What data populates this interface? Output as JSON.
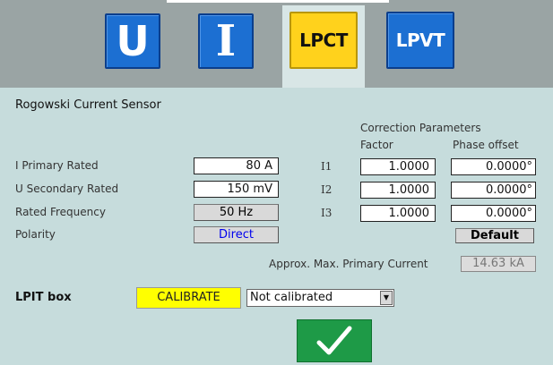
{
  "tabs": [
    {
      "label": "U",
      "active": false
    },
    {
      "label": "I",
      "active": false
    },
    {
      "label": "LPCT",
      "active": true
    },
    {
      "label": "LPVT",
      "active": false
    }
  ],
  "title": "Rogowski Current Sensor",
  "correction": {
    "heading": "Correction Parameters",
    "factor_header": "Factor",
    "phase_header": "Phase offset",
    "rows": [
      {
        "label": "I1",
        "factor": "1.0000",
        "phase": "0.0000°"
      },
      {
        "label": "I2",
        "factor": "1.0000",
        "phase": "0.0000°"
      },
      {
        "label": "I3",
        "factor": "1.0000",
        "phase": "0.0000°"
      }
    ],
    "default_label": "Default"
  },
  "params": {
    "primary_rated_label": "I Primary Rated",
    "primary_rated_value": "80 A",
    "secondary_rated_label": "U Secondary Rated",
    "secondary_rated_value": "150 mV",
    "frequency_label": "Rated Frequency",
    "frequency_value": "50 Hz",
    "polarity_label": "Polarity",
    "polarity_value": "Direct"
  },
  "approx": {
    "label": "Approx. Max. Primary Current",
    "value": "14.63 kA"
  },
  "lpit": {
    "label": "LPIT box",
    "calibrate_label": "CALIBRATE",
    "status_value": "Not calibrated"
  },
  "colors": {
    "tab_blue": "#1c6fd2",
    "tab_active": "#ffd21c",
    "panel_bg": "#c6dcdc",
    "polarity_text": "#0000ee",
    "calibrate_bg": "#ffff00",
    "ok_green": "#1e9a47"
  },
  "icons": {
    "ok": "checkmark-icon",
    "dropdown": "triangle-down-icon"
  }
}
